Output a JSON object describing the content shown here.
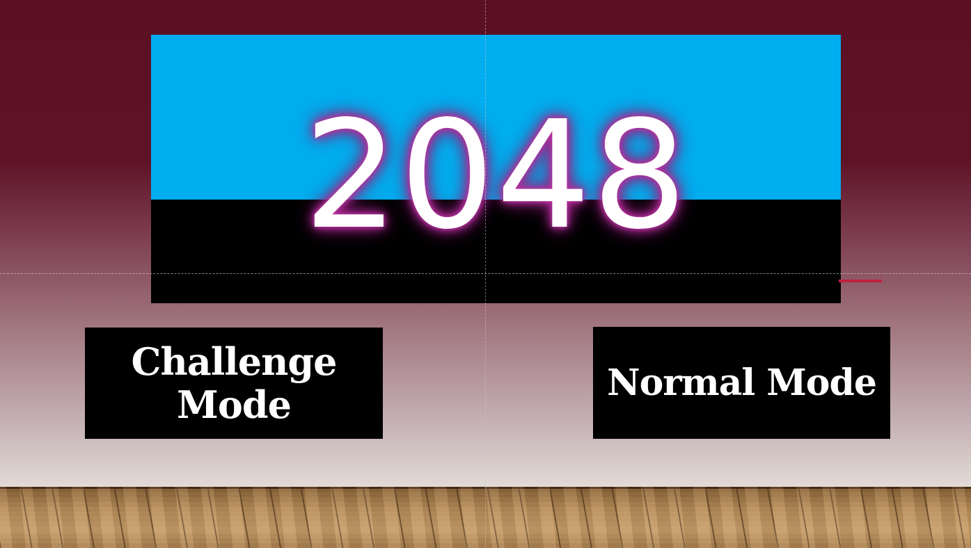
{
  "logo": {
    "text": "2048",
    "top_color": "#00aeef",
    "bottom_color": "#000000",
    "glow_color": "#b2309a"
  },
  "buttons": {
    "challenge_label": "Challenge Mode",
    "normal_label": "Normal Mode"
  },
  "colors": {
    "wall_top": "#5c1023",
    "wall_bottom": "#e3dcd8",
    "accent": "#c2203f",
    "button_bg": "#000000",
    "button_text": "#ffffff"
  }
}
